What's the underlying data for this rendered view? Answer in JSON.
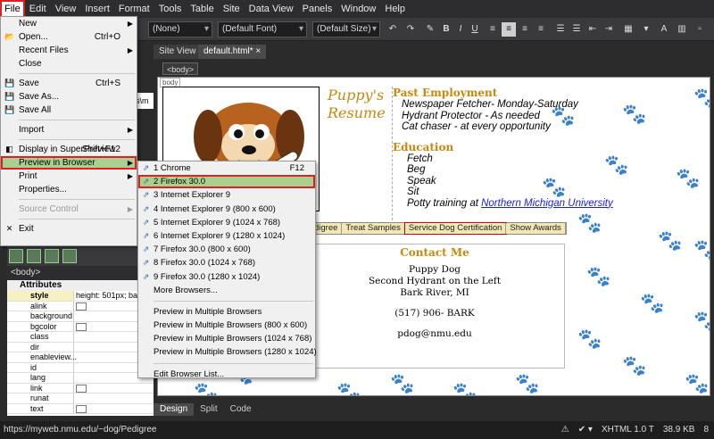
{
  "menubar": [
    "File",
    "Edit",
    "View",
    "Insert",
    "Format",
    "Tools",
    "Table",
    "Site",
    "Data View",
    "Panels",
    "Window",
    "Help"
  ],
  "toolbar": {
    "style_select": "(None)",
    "font_select": "(Default Font)",
    "size_select": "(Default Size)",
    "bold": "B",
    "italic": "I",
    "underline": "U"
  },
  "tabs": [
    "Site View",
    "default.html*"
  ],
  "code_strip_text": "s\\m",
  "tag_label": "<body>",
  "file_menu": [
    {
      "label": "New",
      "shortcut": "",
      "arrow": true,
      "icon": ""
    },
    {
      "label": "Open...",
      "shortcut": "Ctrl+O",
      "arrow": false,
      "icon": "folder"
    },
    {
      "label": "Recent Files",
      "shortcut": "",
      "arrow": true,
      "icon": ""
    },
    {
      "label": "Close",
      "shortcut": "",
      "arrow": false,
      "icon": ""
    },
    {
      "sep": true
    },
    {
      "label": "Save",
      "shortcut": "Ctrl+S",
      "arrow": false,
      "icon": "disk"
    },
    {
      "label": "Save As...",
      "shortcut": "",
      "arrow": false,
      "icon": "disk"
    },
    {
      "label": "Save All",
      "shortcut": "",
      "arrow": false,
      "icon": "disk"
    },
    {
      "sep": true
    },
    {
      "label": "Import",
      "shortcut": "",
      "arrow": true,
      "icon": ""
    },
    {
      "sep": true
    },
    {
      "label": "Display in SuperPreview",
      "shortcut": "Shift+F12",
      "arrow": false,
      "icon": "sp"
    },
    {
      "label": "Preview in Browser",
      "shortcut": "",
      "arrow": true,
      "icon": "",
      "hover": true
    },
    {
      "label": "Print",
      "shortcut": "",
      "arrow": true,
      "icon": ""
    },
    {
      "label": "Properties...",
      "shortcut": "",
      "arrow": false,
      "icon": ""
    },
    {
      "sep": true
    },
    {
      "label": "Source Control",
      "shortcut": "",
      "arrow": true,
      "icon": "",
      "disabled": true
    },
    {
      "sep": true
    },
    {
      "label": "Exit",
      "shortcut": "",
      "arrow": false,
      "icon": "x"
    }
  ],
  "preview_menu": [
    {
      "label": "1 Chrome",
      "shortcut": "F12",
      "icon": true
    },
    {
      "label": "2 Firefox 30.0",
      "shortcut": "",
      "icon": true,
      "hover": true
    },
    {
      "label": "3 Internet Explorer 9",
      "shortcut": "",
      "icon": true
    },
    {
      "label": "4 Internet Explorer 9 (800 x 600)",
      "shortcut": "",
      "icon": true
    },
    {
      "label": "5 Internet Explorer 9 (1024 x 768)",
      "shortcut": "",
      "icon": true
    },
    {
      "label": "6 Internet Explorer 9 (1280 x 1024)",
      "shortcut": "",
      "icon": true
    },
    {
      "label": "7 Firefox 30.0 (800 x 600)",
      "shortcut": "",
      "icon": true
    },
    {
      "label": "8 Firefox 30.0 (1024 x 768)",
      "shortcut": "",
      "icon": true
    },
    {
      "label": "9 Firefox 30.0 (1280 x 1024)",
      "shortcut": "",
      "icon": true
    },
    {
      "label": "More Browsers...",
      "shortcut": "",
      "icon": false
    },
    {
      "sep": true
    },
    {
      "label": "Preview in Multiple Browsers",
      "shortcut": "",
      "icon": false
    },
    {
      "label": "Preview in Multiple Browsers (800 x 600)",
      "shortcut": "",
      "icon": false
    },
    {
      "label": "Preview in Multiple Browsers (1024 x 768)",
      "shortcut": "",
      "icon": false
    },
    {
      "label": "Preview in Multiple Browsers (1280 x 1024)",
      "shortcut": "",
      "icon": false
    },
    {
      "sep": true
    },
    {
      "label": "Edit Browser List...",
      "shortcut": "",
      "icon": false
    }
  ],
  "props_panel": {
    "tag": "<body>",
    "header": "Attributes",
    "rows": [
      {
        "name": "style",
        "value": "height: 501px; ba...",
        "highlight": true
      },
      {
        "name": "alink",
        "value": "",
        "check": true
      },
      {
        "name": "background",
        "value": ""
      },
      {
        "name": "bgcolor",
        "value": "",
        "check": true
      },
      {
        "name": "class",
        "value": ""
      },
      {
        "name": "dir",
        "value": ""
      },
      {
        "name": "enableview...",
        "value": ""
      },
      {
        "name": "id",
        "value": ""
      },
      {
        "name": "lang",
        "value": ""
      },
      {
        "name": "link",
        "value": "",
        "check": true
      },
      {
        "name": "runat",
        "value": ""
      },
      {
        "name": "text",
        "value": "",
        "check": true
      }
    ]
  },
  "page": {
    "body_label": "body",
    "title_line1": "Puppy's",
    "title_line2": "Resume",
    "past_heading": "Past Employment",
    "past_items": [
      "Newspaper Fetcher- Monday-Saturday",
      "Hydrant Protector - As needed",
      "Cat chaser - at every opportunity"
    ],
    "edu_heading": "Education",
    "edu_items": [
      "Fetch",
      "Beg",
      "Speak",
      "Sit"
    ],
    "edu_last_prefix": "Potty training at ",
    "edu_last_link": "Northern Michigan University",
    "nav": [
      "digree",
      "Treat Samples",
      "Service Dog Certification",
      "Show Awards"
    ],
    "contact_heading": "Contact Me",
    "contact_lines": [
      "Puppy Dog",
      "Second Hydrant on the Left",
      "Bark River, MI"
    ],
    "phone": "(517) 906- BARK",
    "email": "pdog@nmu.edu"
  },
  "viewtabs": [
    "Design",
    "Split",
    "Code"
  ],
  "status": {
    "url": "https://myweb.nmu.edu/~dog/Pedigree",
    "doctype": "XHTML 1.0 T",
    "size": "38.9 KB",
    "dims": "8"
  },
  "colors": {
    "accent_red": "#e02020",
    "hover_green": "#a9d08e",
    "heading_gold": "#c8870e",
    "paw_yellow": "#f2c744"
  }
}
